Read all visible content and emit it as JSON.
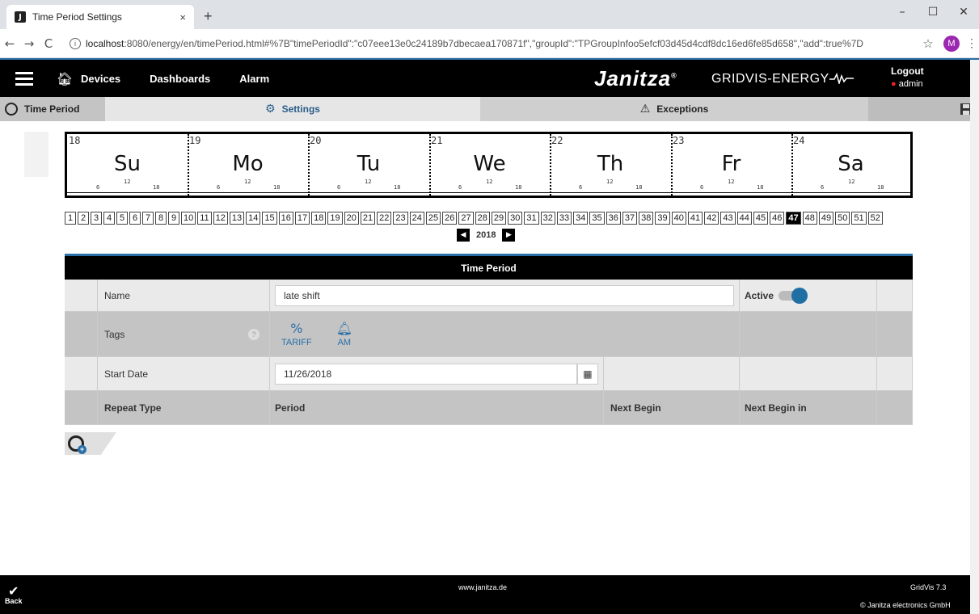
{
  "browser": {
    "tab_title": "Time Period Settings",
    "tab_close": "×",
    "new_tab": "+",
    "win_min": "–",
    "win_max": "☐",
    "win_close": "✕",
    "back": "←",
    "forward": "→",
    "reload": "C",
    "url_host": "localhost",
    "url_rest": ":8080/energy/en/timePeriod.html#%7B\"timePeriodId\":\"c07eee13e0c24189b7dbecaea170871f\",\"groupId\":\"TPGroupInfoo5efcf03d45d4cdf8dc16ed6fe85d658\",\"add\":true%7D",
    "star": "☆",
    "profile": "M",
    "menu": "⋮"
  },
  "header": {
    "menu": [
      "Devices",
      "Dashboards",
      "Alarm"
    ],
    "brand": "Janitza",
    "brand_reg": "®",
    "product": "GRIDVIS-ENERGY",
    "logout": "Logout",
    "user": "admin"
  },
  "tabs": {
    "time_period": "Time Period",
    "settings": "Settings",
    "exceptions": "Exceptions"
  },
  "week": {
    "days": [
      {
        "num": "18",
        "name": "Su"
      },
      {
        "num": "19",
        "name": "Mo"
      },
      {
        "num": "20",
        "name": "Tu"
      },
      {
        "num": "21",
        "name": "We"
      },
      {
        "num": "22",
        "name": "Th"
      },
      {
        "num": "23",
        "name": "Fr"
      },
      {
        "num": "24",
        "name": "Sa"
      }
    ],
    "ticks": [
      "6",
      "12",
      "18"
    ],
    "week_numbers": [
      "1",
      "2",
      "3",
      "4",
      "5",
      "6",
      "7",
      "8",
      "9",
      "10",
      "11",
      "12",
      "13",
      "14",
      "15",
      "16",
      "17",
      "18",
      "19",
      "20",
      "21",
      "22",
      "23",
      "24",
      "25",
      "26",
      "27",
      "28",
      "29",
      "30",
      "31",
      "32",
      "33",
      "34",
      "35",
      "36",
      "37",
      "38",
      "39",
      "40",
      "41",
      "42",
      "43",
      "44",
      "45",
      "46",
      "47",
      "48",
      "49",
      "50",
      "51",
      "52"
    ],
    "active_week": "47",
    "year": "2018"
  },
  "form": {
    "title": "Time Period",
    "name_label": "Name",
    "name_value": "late shift",
    "active_label": "Active",
    "tags_label": "Tags",
    "tags": [
      {
        "label": "TARIFF",
        "icon": "%"
      },
      {
        "label": "AM",
        "icon": "🔔"
      }
    ],
    "start_label": "Start Date",
    "start_value": "11/26/2018",
    "col_repeat": "Repeat Type",
    "col_period": "Period",
    "col_next_begin": "Next Begin",
    "col_next_begin_in": "Next Begin in"
  },
  "footer": {
    "back": "Back",
    "site": "www.janitza.de",
    "version": "GridVis 7.3",
    "copyright": "© Janitza electronics GmbH"
  }
}
